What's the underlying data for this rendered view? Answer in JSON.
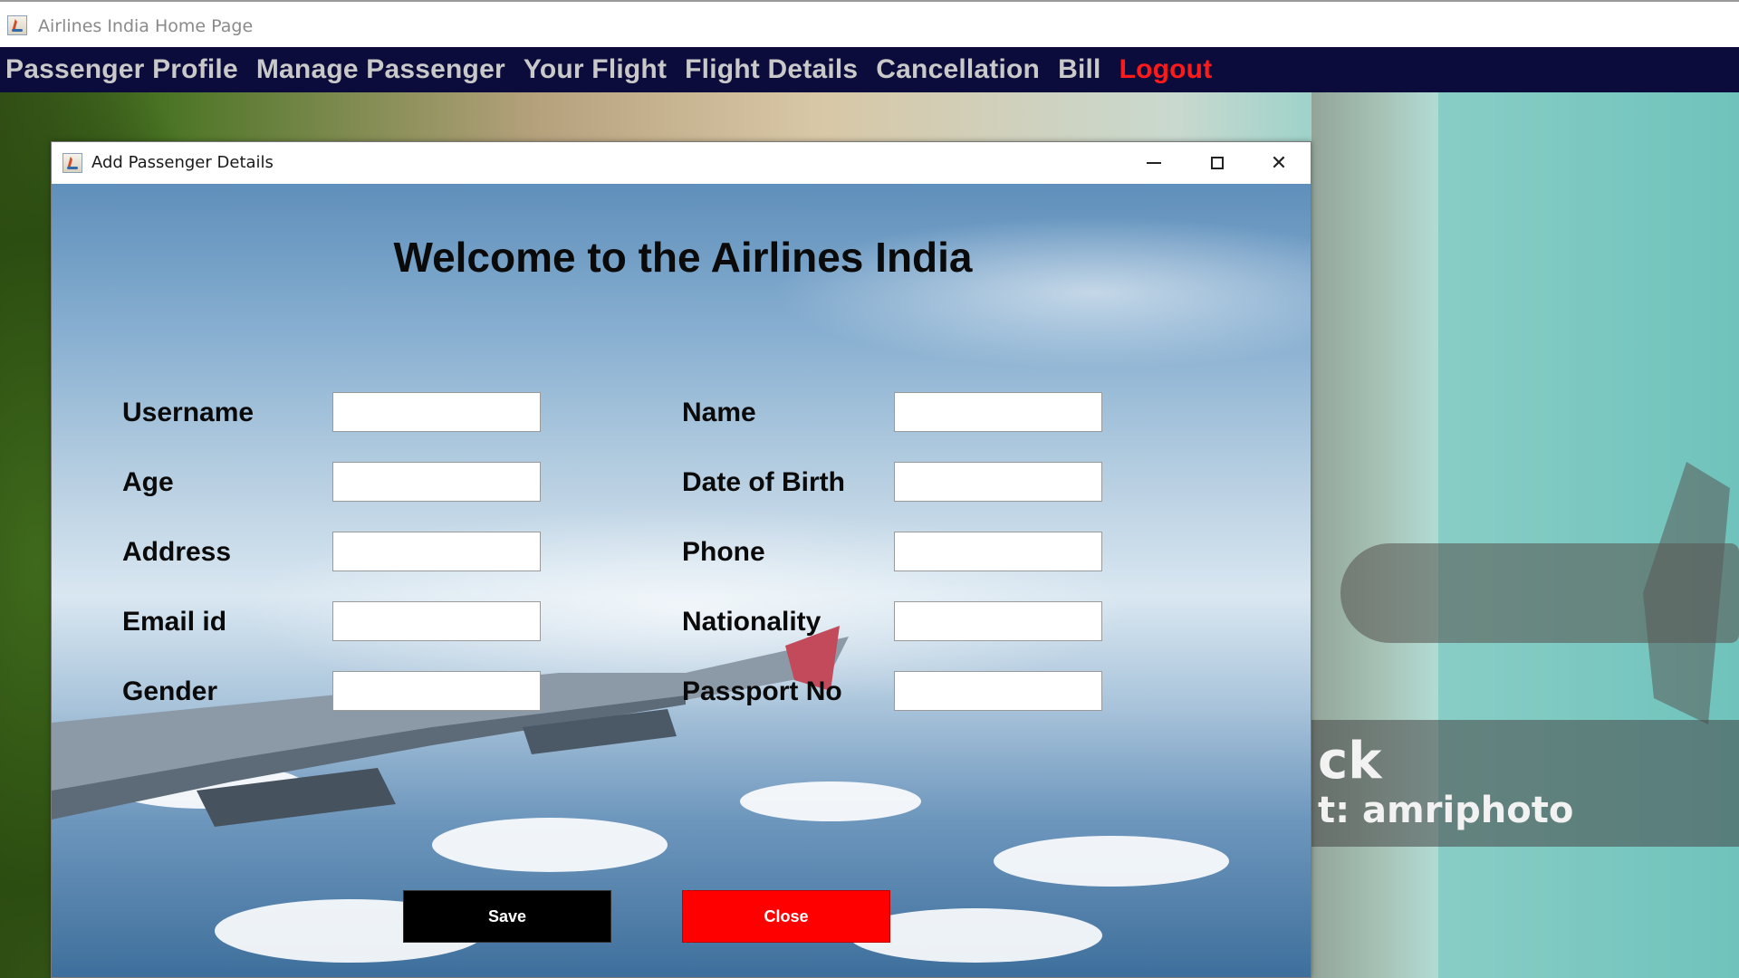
{
  "main_window": {
    "title": "Airlines India Home Page"
  },
  "menu": {
    "items": [
      {
        "label": "Passenger Profile"
      },
      {
        "label": "Manage Passenger"
      },
      {
        "label": "Your Flight"
      },
      {
        "label": "Flight Details"
      },
      {
        "label": "Cancellation"
      },
      {
        "label": "Bill"
      },
      {
        "label": "Logout"
      }
    ],
    "logout_color": "#ff1a1a",
    "bar_color": "#0b0b3c"
  },
  "background_watermark": {
    "line1": "ck",
    "line2": "t: amriphoto"
  },
  "dialog": {
    "title": "Add Passenger Details",
    "heading": "Welcome to the Airlines India",
    "fields_left": [
      {
        "label": "Username",
        "value": ""
      },
      {
        "label": "Age",
        "value": ""
      },
      {
        "label": "Address",
        "value": ""
      },
      {
        "label": "Email id",
        "value": ""
      },
      {
        "label": "Gender",
        "value": ""
      }
    ],
    "fields_right": [
      {
        "label": "Name",
        "value": ""
      },
      {
        "label": "Date of Birth",
        "value": ""
      },
      {
        "label": "Phone",
        "value": ""
      },
      {
        "label": "Nationality",
        "value": ""
      },
      {
        "label": "Passport No",
        "value": ""
      }
    ],
    "save_label": "Save",
    "close_label": "Close",
    "save_color": "#000000",
    "close_color": "#ff0000"
  }
}
